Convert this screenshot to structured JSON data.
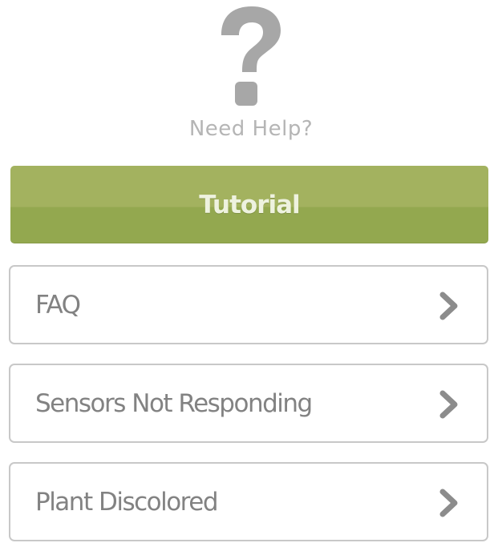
{
  "header": {
    "icon": "question-mark-icon",
    "title": "Need Help?"
  },
  "tutorial": {
    "label": "Tutorial"
  },
  "items": [
    {
      "label": "FAQ",
      "icon": "chevron-right-icon"
    },
    {
      "label": "Sensors Not Responding",
      "icon": "chevron-right-icon"
    },
    {
      "label": "Plant Discolored",
      "icon": "chevron-right-icon"
    }
  ],
  "colors": {
    "accent": "#9CAE5A",
    "text": "#828282",
    "icon": "#A7A7A7",
    "border": "#C8C8C8"
  }
}
